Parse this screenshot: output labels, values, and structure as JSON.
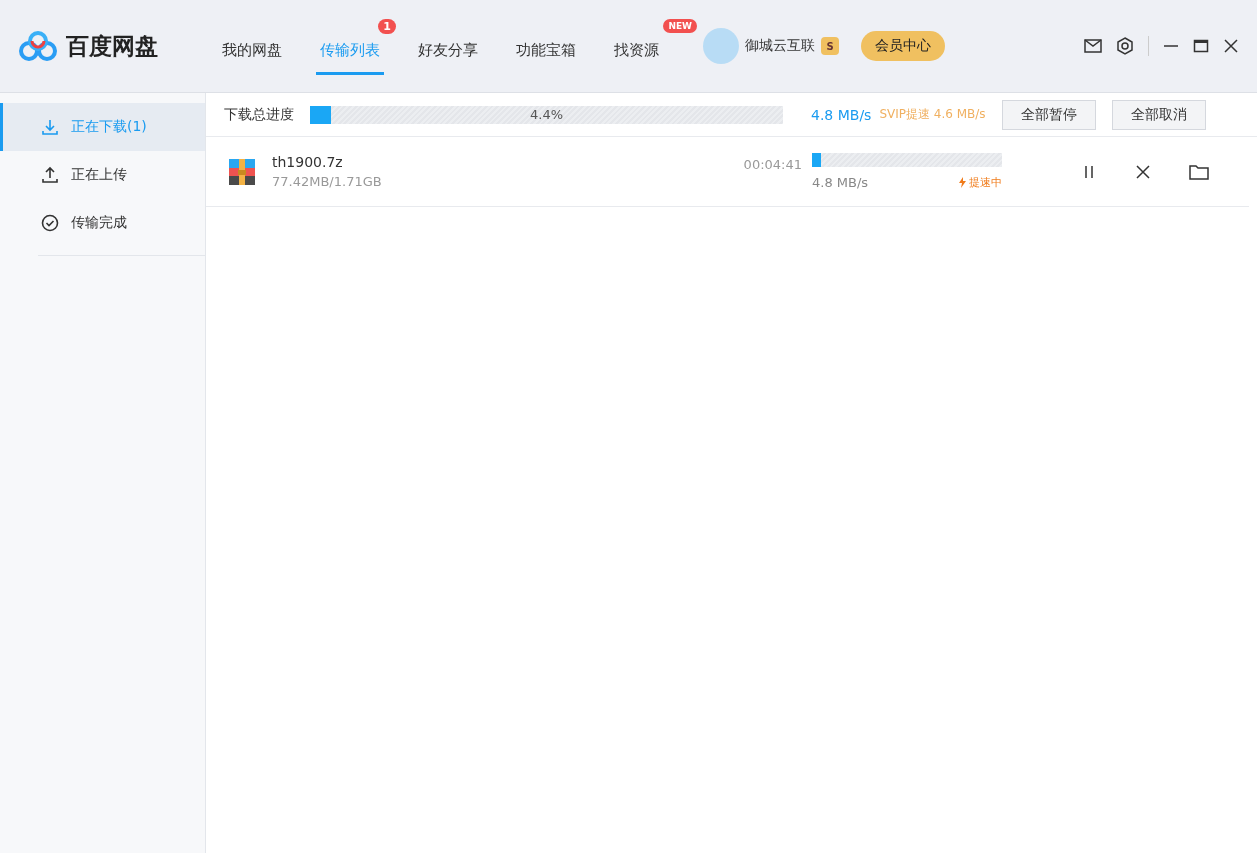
{
  "app": {
    "title": "百度网盘"
  },
  "nav": [
    {
      "label": "我的网盘",
      "selected": false
    },
    {
      "label": "传输列表",
      "selected": true,
      "badge": {
        "text": "1",
        "kind": "count"
      }
    },
    {
      "label": "好友分享",
      "selected": false
    },
    {
      "label": "功能宝箱",
      "selected": false
    },
    {
      "label": "找资源",
      "selected": false,
      "badge": {
        "text": "NEW",
        "kind": "tag"
      }
    }
  ],
  "user": {
    "name": "御城云互联",
    "vip_mark": "S"
  },
  "member_button": "会员中心",
  "sidebar": [
    {
      "label": "正在下载(1)",
      "kind": "download",
      "selected": true
    },
    {
      "label": "正在上传",
      "kind": "upload",
      "selected": false
    },
    {
      "label": "传输完成",
      "kind": "done",
      "selected": false
    }
  ],
  "summary": {
    "label": "下载总进度",
    "level": 0.044,
    "percent": "4.4%",
    "speed": "4.8 MB/s",
    "svip": "SVIP提速 4.6 MB/s",
    "buttons": [
      "全部暂停",
      "全部取消"
    ]
  },
  "files": [
    {
      "name": "th1900.7z",
      "size": "77.42MB/1.71GB",
      "time_left": "00:04:41",
      "level": 0.045,
      "speed": "4.8 MB/s",
      "boost": "提速中"
    }
  ]
}
